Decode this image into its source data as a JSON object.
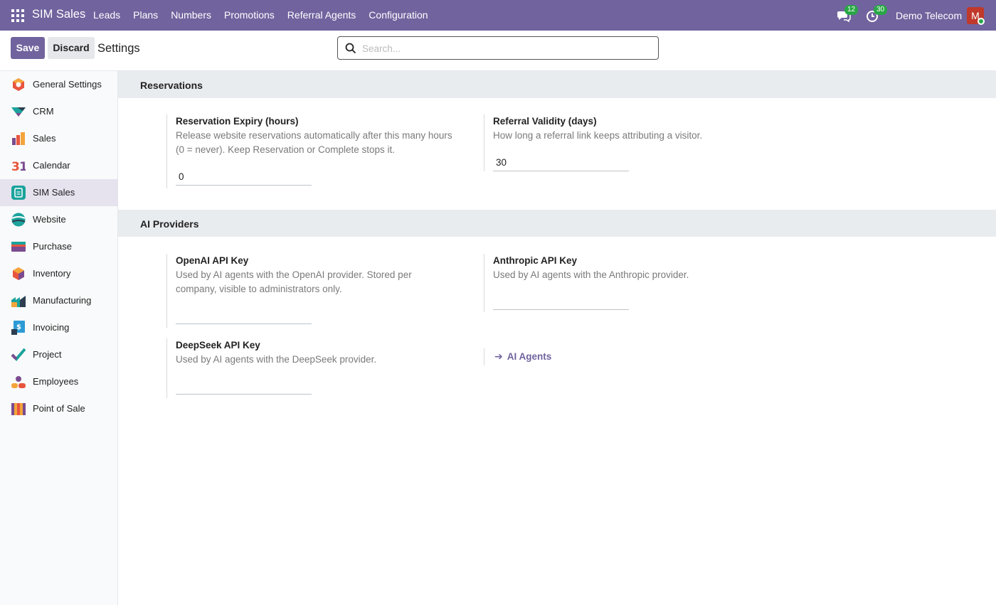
{
  "navbar": {
    "app_name": "SIM Sales",
    "menu": [
      "Leads",
      "Plans",
      "Numbers",
      "Promotions",
      "Referral Agents",
      "Configuration"
    ],
    "messages_count": "12",
    "activities_count": "30",
    "company": "Demo Telecom",
    "avatar_initial": "M"
  },
  "control": {
    "save_label": "Save",
    "discard_label": "Discard",
    "title": "Settings",
    "search_placeholder": "Search..."
  },
  "sidebar": {
    "active": "SIM Sales",
    "items": [
      {
        "label": "General Settings",
        "icon": "general-settings-icon"
      },
      {
        "label": "CRM",
        "icon": "crm-icon"
      },
      {
        "label": "Sales",
        "icon": "sales-icon"
      },
      {
        "label": "Calendar",
        "icon": "calendar-icon"
      },
      {
        "label": "SIM Sales",
        "icon": "sim-sales-icon"
      },
      {
        "label": "Website",
        "icon": "website-icon"
      },
      {
        "label": "Purchase",
        "icon": "purchase-icon"
      },
      {
        "label": "Inventory",
        "icon": "inventory-icon"
      },
      {
        "label": "Manufacturing",
        "icon": "manufacturing-icon"
      },
      {
        "label": "Invoicing",
        "icon": "invoicing-icon"
      },
      {
        "label": "Project",
        "icon": "project-icon"
      },
      {
        "label": "Employees",
        "icon": "employees-icon"
      },
      {
        "label": "Point of Sale",
        "icon": "point-of-sale-icon"
      }
    ]
  },
  "sections": {
    "reservations": {
      "title": "Reservations",
      "expiry": {
        "title": "Reservation Expiry (hours)",
        "desc_line1": "Release website reservations automatically after this many hours",
        "desc_line2": "(0 = never). Keep Reservation or Complete stops it.",
        "value": "0"
      },
      "referral": {
        "title": "Referral Validity (days)",
        "desc": "How long a referral link keeps attributing a visitor.",
        "value": "30"
      }
    },
    "ai": {
      "title": "AI Providers",
      "openai": {
        "title": "OpenAI API Key",
        "desc_line1": "Used by AI agents with the OpenAI provider. Stored per",
        "desc_line2": "company, visible to administrators only.",
        "value": ""
      },
      "anthropic": {
        "title": "Anthropic API Key",
        "desc": "Used by AI agents with the Anthropic provider.",
        "value": ""
      },
      "deepseek": {
        "title": "DeepSeek API Key",
        "desc": "Used by AI agents with the DeepSeek provider.",
        "value": ""
      },
      "agents_link": "AI Agents"
    }
  },
  "colors": {
    "brand": "#71639e",
    "badge": "#28a745",
    "section_bg": "#e9ecef"
  }
}
